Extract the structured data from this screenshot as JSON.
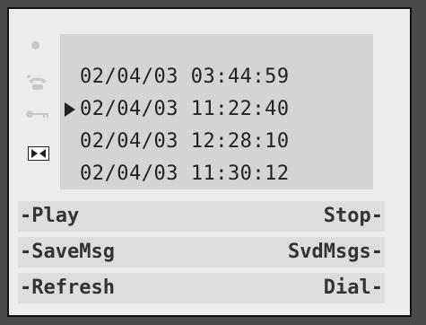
{
  "messages": [
    {
      "timestamp": "02/04/03 03:44:59",
      "selected": false
    },
    {
      "timestamp": "02/04/03 11:22:40",
      "selected": true
    },
    {
      "timestamp": "02/04/03 12:28:10",
      "selected": false
    },
    {
      "timestamp": "02/04/03 11:30:12",
      "selected": false
    }
  ],
  "softkeys": {
    "row1": {
      "left": "-Play",
      "right": "Stop-"
    },
    "row2": {
      "left": "-SaveMsg",
      "right": "SvdMsgs-"
    },
    "row3": {
      "left": "-Refresh",
      "right": "Dial-"
    }
  },
  "icons": {
    "dot": "dot-icon",
    "phone": "phone-icon",
    "key": "key-icon",
    "skip": "skip-icon"
  },
  "colors": {
    "background": "#4a4a4a",
    "frame": "#ececec",
    "panel": "#d4d4d4",
    "softkey_row": "#dddddd",
    "text": "#222222"
  }
}
